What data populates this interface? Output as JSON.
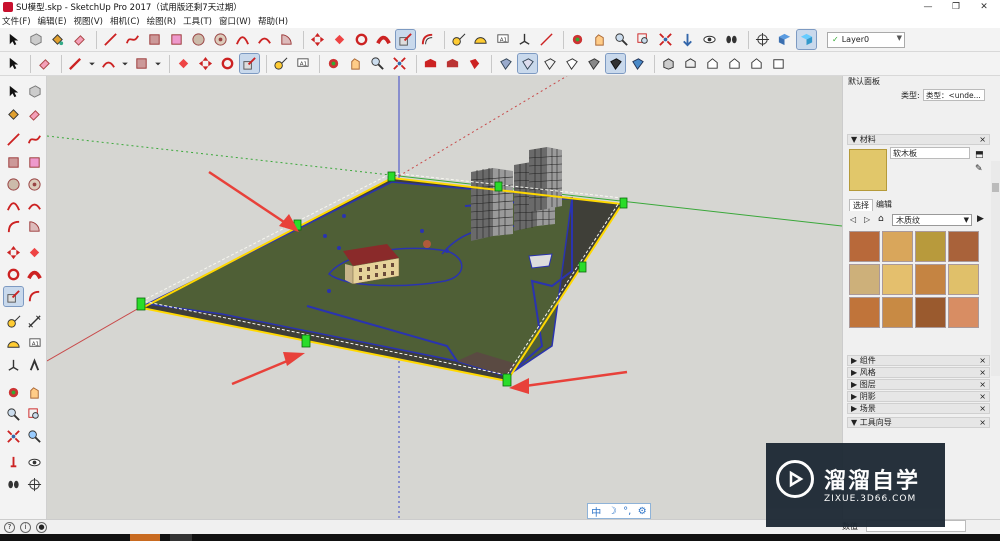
{
  "window": {
    "title": "SU模型.skp - SketchUp Pro 2017（试用版还剩7天过期）",
    "controls": [
      "—",
      "❐",
      "✕"
    ]
  },
  "menu": [
    "文件(F)",
    "编辑(E)",
    "视图(V)",
    "相机(C)",
    "绘图(R)",
    "工具(T)",
    "窗口(W)",
    "帮助(H)"
  ],
  "layer": {
    "value": "Layer0"
  },
  "panel": {
    "title": "默认面板",
    "type_label": "类型:",
    "type_value": "类型：<unde...",
    "materials_section": "材料",
    "material_name": "软木板",
    "tab_select": "选择",
    "tab_edit": "编辑",
    "library": "木质纹",
    "swatch_colors": [
      "#b8693a",
      "#d9a65b",
      "#b89a3c",
      "#a9623a",
      "#cdb07a",
      "#e4bf6d",
      "#c58442",
      "#e0c06a",
      "#c0743a",
      "#c88a44",
      "#9a5a2e",
      "#d88d63"
    ],
    "sections": [
      "组件",
      "风格",
      "图层",
      "阴影",
      "场景",
      "工具向导"
    ]
  },
  "view_toggle": {
    "labels": [
      "中",
      "☽",
      "°,",
      "⚙"
    ]
  },
  "status": {
    "measure_label": "数值"
  },
  "watermark": {
    "brand": "溜溜自学",
    "url": "ZIXUE.3D66.COM"
  },
  "colors": {
    "accent": "#2a72c7",
    "selection": "#ffd800",
    "terrain": "#4f5f36",
    "arrow": "#e8413a"
  }
}
